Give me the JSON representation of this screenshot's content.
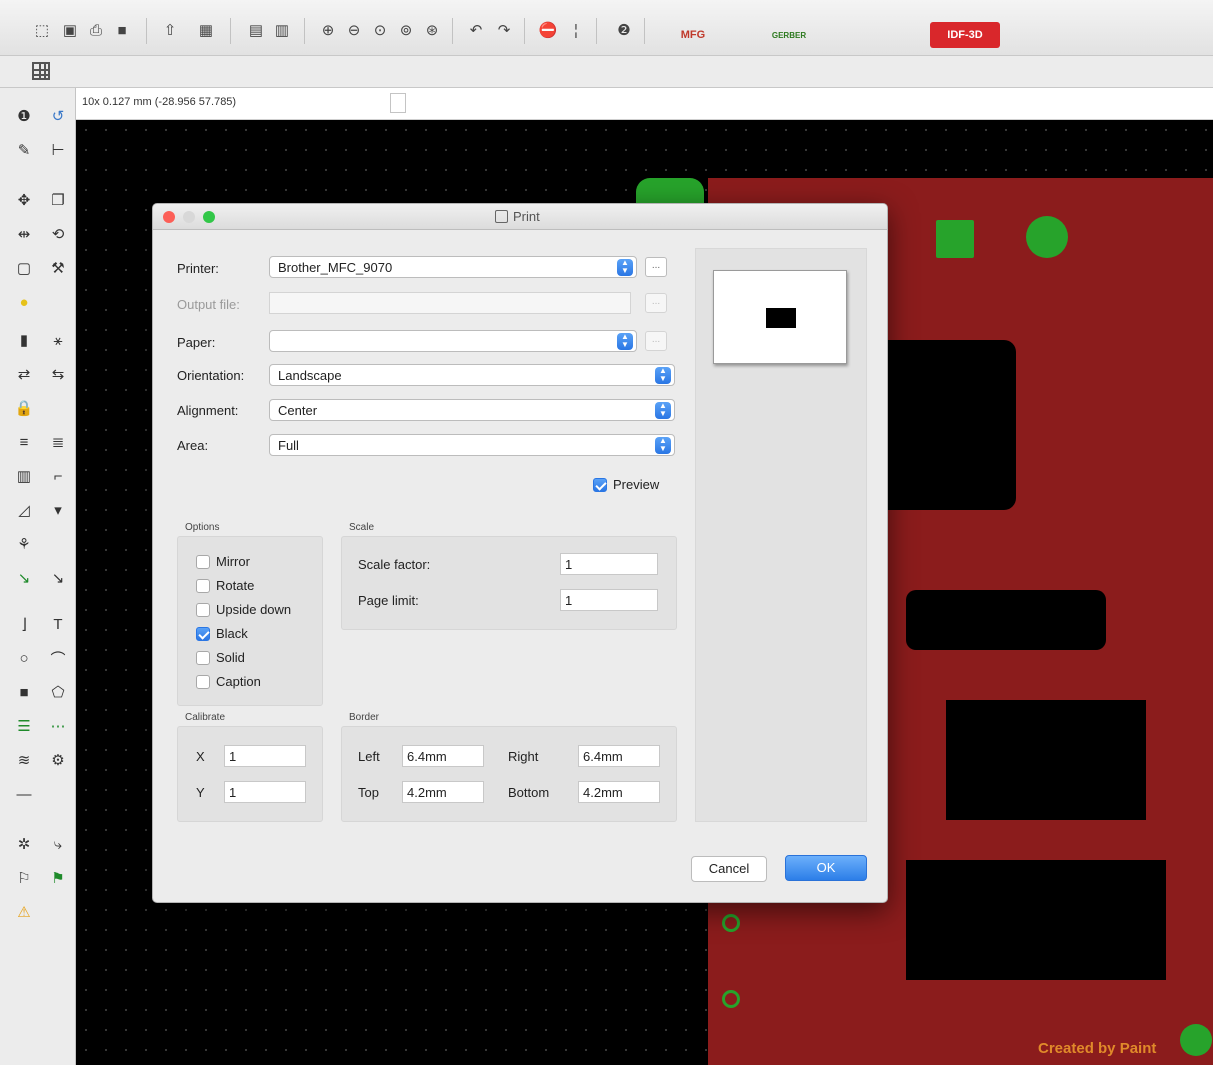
{
  "toolbar": {
    "icons": [
      "new-file-icon",
      "save-icon",
      "print-icon",
      "plot-icon",
      "import-icon",
      "netlist-icon",
      "layers-icon",
      "layers-copper-icon",
      "zoom-in-icon",
      "zoom-out-icon",
      "zoom-redraw-icon",
      "zoom-fit-icon",
      "zoom-selection-icon",
      "undo-icon",
      "redo-icon",
      "drc-icon",
      "mode-icon",
      "scripting-icon"
    ],
    "badges": {
      "badge1": "MFG",
      "badge2": "GERBER",
      "idf": "IDF-3D"
    },
    "colors": {
      "idf_badge": "#d9272b"
    }
  },
  "coord_bar": {
    "text": "10x 0.127 mm (-28.956 57.785)"
  },
  "canvas": {
    "watermark": "Created by Paint"
  },
  "dialog": {
    "title": "Print",
    "printer_label": "Printer:",
    "printer_value": "Brother_MFC_9070",
    "output_file_label": "Output file:",
    "output_file_value": "",
    "paper_label": "Paper:",
    "paper_value": "",
    "orientation_label": "Orientation:",
    "orientation_value": "Landscape",
    "alignment_label": "Alignment:",
    "alignment_value": "Center",
    "area_label": "Area:",
    "area_value": "Full",
    "dots": "...",
    "preview_label": "Preview",
    "options_title": "Options",
    "options": [
      {
        "label": "Mirror",
        "checked": false
      },
      {
        "label": "Rotate",
        "checked": false
      },
      {
        "label": "Upside down",
        "checked": false
      },
      {
        "label": "Black",
        "checked": true
      },
      {
        "label": "Solid",
        "checked": false
      },
      {
        "label": "Caption",
        "checked": false
      }
    ],
    "scale_title": "Scale",
    "scale_factor_label": "Scale factor:",
    "scale_factor_value": "1",
    "page_limit_label": "Page limit:",
    "page_limit_value": "1",
    "calibrate_title": "Calibrate",
    "x_label": "X",
    "x_value": "1",
    "y_label": "Y",
    "y_value": "1",
    "border_title": "Border",
    "left_label": "Left",
    "left_value": "6.4mm",
    "right_label": "Right",
    "right_value": "6.4mm",
    "top_label": "Top",
    "top_value": "4.2mm",
    "bottom_label": "Bottom",
    "bottom_value": "4.2mm",
    "cancel_label": "Cancel",
    "ok_label": "OK"
  }
}
